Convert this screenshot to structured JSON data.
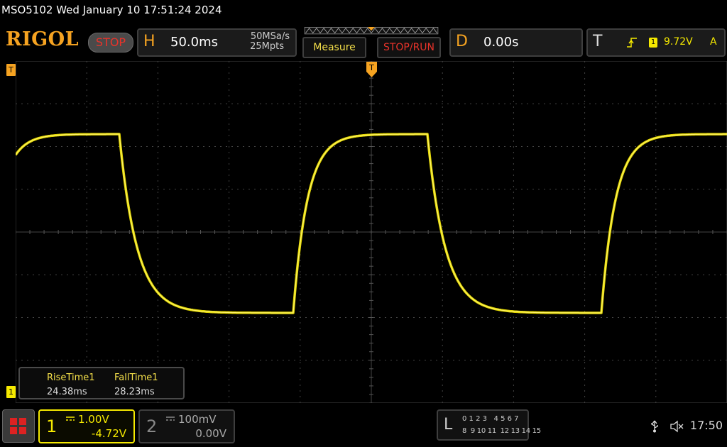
{
  "header": {
    "title": "MSO5102  Wed January 10 17:51:24 2024",
    "logo": "RIGOL",
    "run_state": "STOP"
  },
  "horizontal": {
    "letter": "H",
    "timebase": "50.0ms",
    "sample_rate": "50MSa/s",
    "memory_depth": "25Mpts"
  },
  "buttons": {
    "measure": "Measure",
    "stop_run": "STOP/RUN"
  },
  "delay": {
    "letter": "D",
    "value": "0.00s"
  },
  "trigger": {
    "letter": "T",
    "edge_icon": "rising-edge-icon",
    "source": "1",
    "level": "9.72V",
    "mode": "A"
  },
  "markers": {
    "trigger_pos": "T",
    "level_marker": "T",
    "ch1_marker": "1"
  },
  "measurements": [
    {
      "label": "RiseTime1",
      "value": "24.38ms"
    },
    {
      "label": "FallTime1",
      "value": "28.23ms"
    }
  ],
  "channels": [
    {
      "number": "1",
      "coupling_icon": "dc-coupling-icon",
      "scale": "1.00V",
      "offset": "-4.72V",
      "active": true
    },
    {
      "number": "2",
      "coupling_icon": "dc-coupling-icon",
      "scale": "100mV",
      "offset": "0.00V",
      "active": false
    }
  ],
  "logic": {
    "letter": "L",
    "row1": "0 1 2 3   4 5 6 7",
    "row2": "8  9 10 11  12 13 14 15"
  },
  "status": {
    "usb_icon": "usb-icon",
    "speaker_icon": "speaker-muted-icon",
    "clock": "17:50"
  },
  "colors": {
    "accent": "#f6a321",
    "ch1": "#f5e900",
    "stop_red": "#e8332a"
  }
}
